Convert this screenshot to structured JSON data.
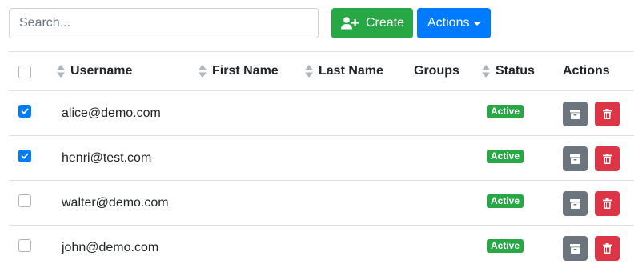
{
  "search": {
    "placeholder": "Search...",
    "value": ""
  },
  "toolbar": {
    "create_label": "Create",
    "actions_label": "Actions"
  },
  "table": {
    "columns": [
      "Username",
      "First Name",
      "Last Name",
      "Groups",
      "Status",
      "Actions"
    ],
    "rows": [
      {
        "username": "alice@demo.com",
        "first_name": "",
        "last_name": "",
        "groups": "",
        "status": "Active",
        "checked": true
      },
      {
        "username": "henri@test.com",
        "first_name": "",
        "last_name": "",
        "groups": "",
        "status": "Active",
        "checked": true
      },
      {
        "username": "walter@demo.com",
        "first_name": "",
        "last_name": "",
        "groups": "",
        "status": "Active",
        "checked": false
      },
      {
        "username": "john@demo.com",
        "first_name": "",
        "last_name": "",
        "groups": "",
        "status": "Active",
        "checked": false
      }
    ]
  },
  "icons": {
    "create": "user-plus-icon",
    "archive": "archive-icon",
    "delete": "trash-icon",
    "sort": "sort-icon",
    "dropdown": "caret-down-icon"
  },
  "colors": {
    "success": "#28a745",
    "primary": "#007bff",
    "secondary": "#6c757d",
    "danger": "#dc3545"
  }
}
